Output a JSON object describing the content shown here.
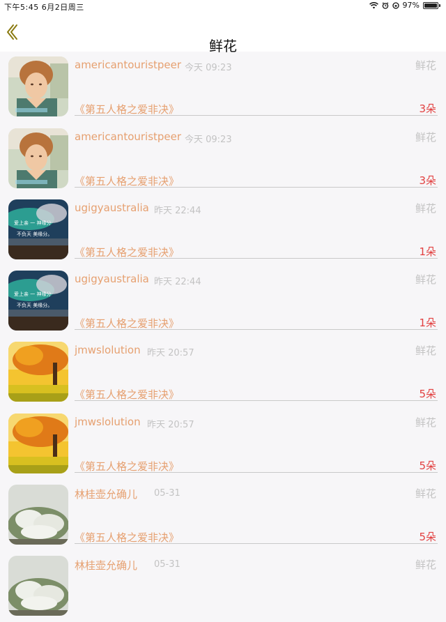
{
  "status_bar": {
    "time_date": "下午5:45   6月2日周三",
    "battery": "97%"
  },
  "nav": {
    "title": "鲜花",
    "back_icon": "chevron-left-icon"
  },
  "rows": [
    {
      "username": "americantouristpeer",
      "time": "今天 09:23",
      "gift": "鲜花",
      "book": "《第五人格之爱非决》",
      "count": "3朵",
      "avatar": "portrait-man"
    },
    {
      "username": "americantouristpeer",
      "time": "今天 09:23",
      "gift": "鲜花",
      "book": "《第五人格之爱非决》",
      "count": "3朵",
      "avatar": "portrait-man"
    },
    {
      "username": "ugigyaustralia",
      "time": "昨天 22:44",
      "gift": "鲜花",
      "book": "《第五人格之爱非决》",
      "count": "1朵",
      "avatar": "aurora-landscape"
    },
    {
      "username": "ugigyaustralia",
      "time": "昨天 22:44",
      "gift": "鲜花",
      "book": "《第五人格之爱非决》",
      "count": "1朵",
      "avatar": "aurora-landscape"
    },
    {
      "username": "jmwslolution",
      "time": "昨天 20:57",
      "gift": "鲜花",
      "book": "《第五人格之爱非决》",
      "count": "5朵",
      "avatar": "autumn-tree"
    },
    {
      "username": "jmwslolution",
      "time": "昨天 20:57",
      "gift": "鲜花",
      "book": "《第五人格之爱非决》",
      "count": "5朵",
      "avatar": "autumn-tree"
    },
    {
      "username": "林桂壶允确儿",
      "time": "05-31",
      "gift": "鲜花",
      "book": "《第五人格之爱非决》",
      "count": "5朵",
      "avatar": "white-flowers"
    },
    {
      "username": "林桂壶允确儿",
      "time": "05-31",
      "gift": "鲜花",
      "book": "",
      "count": "",
      "avatar": "white-flowers"
    }
  ]
}
